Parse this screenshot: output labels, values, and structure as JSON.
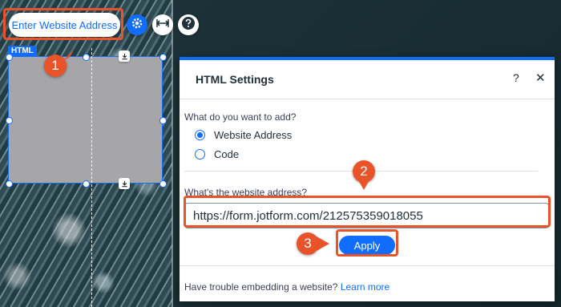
{
  "toolbar": {
    "url_button_label": "Enter Website Address",
    "gear_icon": "gear-icon",
    "stretch_icon": "stretch-horizontal-icon",
    "help_icon": "question-mark-icon"
  },
  "element": {
    "tag_label": "HTML"
  },
  "callouts": [
    "1",
    "2",
    "3"
  ],
  "panel": {
    "title": "HTML Settings",
    "help": "?",
    "close": "✕",
    "question_add": "What do you want to add?",
    "options": [
      {
        "label": "Website Address",
        "selected": true
      },
      {
        "label": "Code",
        "selected": false
      }
    ],
    "question_address": "What's the website address?",
    "url_value": "https://form.jotform.com/212575359018055",
    "apply_label": "Apply",
    "trouble_text": "Have trouble embedding a website?",
    "learn_more": "Learn more"
  },
  "colors": {
    "accent": "#116dff",
    "highlight": "#e8532a"
  }
}
